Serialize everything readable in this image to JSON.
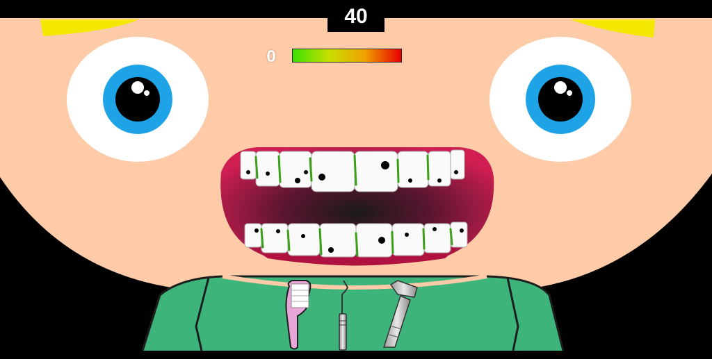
{
  "hud": {
    "timer": "40",
    "dirt_score": "0",
    "meter_level": 1.0
  },
  "tools": [
    {
      "id": "toothbrush",
      "icon": "toothbrush-icon"
    },
    {
      "id": "dental-pick",
      "icon": "dental-pick-icon"
    },
    {
      "id": "dental-drill",
      "icon": "dental-drill-icon"
    }
  ],
  "colors": {
    "skin": "#fdcba8",
    "hair": "#f5e800",
    "iris": "#1ea4e6",
    "gum": "#c6194c",
    "shirt": "#3db57a",
    "plaque": "#3aa018",
    "toothbrush": "#e8a6d8"
  }
}
